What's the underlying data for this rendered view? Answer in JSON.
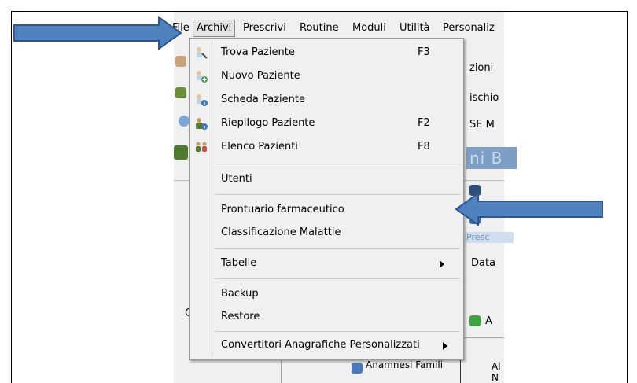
{
  "menubar": {
    "file": "File",
    "archivi": "Archivi",
    "prescrivi": "Prescrivi",
    "routine": "Routine",
    "moduli": "Moduli",
    "utilita": "Utilità",
    "personalizza": "Personaliz"
  },
  "background": {
    "zioni": "zioni",
    "ischio": "ischio",
    "se_m": "SE M",
    "banner": "ni B",
    "presc": "Presc",
    "data": "Data",
    "o_letter": "C",
    "anamnesi": "Anamnesi Famili",
    "al": "Al",
    "n_letter": "N",
    "a_letter": "A"
  },
  "menu": {
    "items": [
      {
        "label": "Trova Paziente",
        "shortcut": "F3"
      },
      {
        "label": "Nuovo Paziente",
        "shortcut": ""
      },
      {
        "label": "Scheda Paziente",
        "shortcut": ""
      },
      {
        "label": "Riepilogo Paziente",
        "shortcut": "F2"
      },
      {
        "label": "Elenco Pazienti",
        "shortcut": "F8"
      },
      {
        "label": "Utenti",
        "shortcut": ""
      },
      {
        "label": "Prontuario farmaceutico",
        "shortcut": ""
      },
      {
        "label": "Classificazione Malattie",
        "shortcut": ""
      },
      {
        "label": "Tabelle",
        "shortcut": ""
      },
      {
        "label": "Backup",
        "shortcut": ""
      },
      {
        "label": "Restore",
        "shortcut": ""
      },
      {
        "label": "Convertitori Anagrafiche Personalizzati",
        "shortcut": ""
      }
    ]
  },
  "colors": {
    "arrow": "#4f81bd",
    "arrow_border": "#2f5597"
  }
}
